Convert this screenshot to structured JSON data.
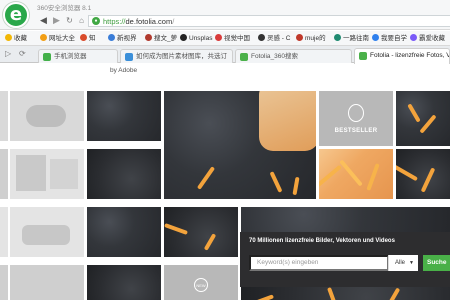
{
  "browser": {
    "window_title": "360安全浏览器 8.1",
    "logo_letter": "e",
    "url_scheme": "https://",
    "url_host": "de.fotolia.com",
    "url_path": "/"
  },
  "bookmarks": [
    {
      "label": "收藏",
      "color": "#f2b705"
    },
    {
      "label": "网址大全",
      "color": "#f29e14"
    },
    {
      "label": "知",
      "color": "#d94b2b"
    },
    {
      "label": "新视界",
      "color": "#3a7dd8"
    },
    {
      "label": "搜文_萝",
      "color": "#b03a2e"
    },
    {
      "label": "Unsplas",
      "color": "#222222"
    },
    {
      "label": "视觉中国",
      "color": "#d83b3b"
    },
    {
      "label": "灵感 - C",
      "color": "#333333"
    },
    {
      "label": "muje的",
      "color": "#c0392b"
    },
    {
      "label": "一路往南",
      "color": "#1f8a70"
    },
    {
      "label": "我要自学",
      "color": "#2f80ed"
    },
    {
      "label": "霸爱收藏",
      "color": "#7a5af8"
    }
  ],
  "tabs": [
    {
      "label": "手机浏览器",
      "icon_color": "#43b04a",
      "active": false
    },
    {
      "label": "如何成为图片素材图库，共选订",
      "icon_color": "#3b8fd9",
      "active": false
    },
    {
      "label": "Fotolia_360搜索",
      "icon_color": "#4bb14a",
      "active": false
    },
    {
      "label": "Fotolia - lizenzfreie Fotos, V",
      "icon_color": "#4bb14a",
      "active": true
    }
  ],
  "page": {
    "by_adobe": "by Adobe",
    "bestseller_label": "BESTSELLER",
    "new_label": "NEW",
    "search": {
      "headline": "70 Millionen lizenzfreie Bilder, Vektoren und Videos",
      "placeholder": "Keyword(s) eingeben",
      "filter_value": "Alle",
      "button_label": "Suche"
    }
  }
}
